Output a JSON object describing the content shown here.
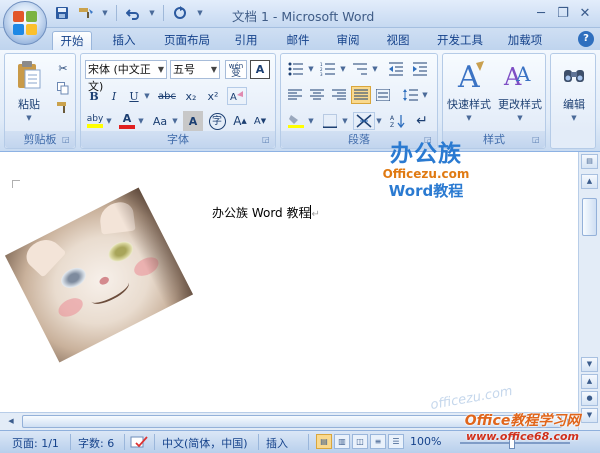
{
  "window": {
    "title": "文档 1 - Microsoft Word"
  },
  "qat": {
    "icons": [
      "save-icon",
      "format-painter-icon",
      "undo-icon",
      "redo-icon",
      "customize-icon"
    ]
  },
  "tabs": [
    {
      "label": "开始"
    },
    {
      "label": "插入"
    },
    {
      "label": "页面布局"
    },
    {
      "label": "引用"
    },
    {
      "label": "邮件"
    },
    {
      "label": "审阅"
    },
    {
      "label": "视图"
    },
    {
      "label": "开发工具"
    },
    {
      "label": "加载项"
    }
  ],
  "help_label": "?",
  "ribbon": {
    "clipboard": {
      "label": "剪贴板",
      "paste_label": "粘贴"
    },
    "font": {
      "label": "字体",
      "font_name": "宋体 (中文正文)",
      "font_size": "五号",
      "bold": "B",
      "italic": "I",
      "underline": "U",
      "strike": "abc",
      "subscript": "x₂",
      "superscript": "x²",
      "highlight": "aby",
      "font_color": "A",
      "change_case": "Aa",
      "char_shading": "A",
      "enclose": "字",
      "grow": "A",
      "shrink": "A",
      "clear": "A",
      "phonetic": "wén",
      "char_border": "A"
    },
    "paragraph": {
      "label": "段落"
    },
    "styles": {
      "label": "样式",
      "quick_styles": "快速样式",
      "change_styles": "更改样式"
    },
    "editing": {
      "label": "编辑"
    }
  },
  "document": {
    "text": "办公族 Word 教程",
    "para_mark": "↵"
  },
  "watermark": {
    "top": "办公族",
    "mid": "Officezu.com",
    "bot": "Word教程",
    "faint": "officezu.com"
  },
  "status": {
    "page": "页面: 1/1",
    "words": "字数: 6",
    "language": "中文(简体，中国)",
    "insert": "插入",
    "zoom": "100%"
  },
  "footer_brand": {
    "top": "Office教程学习网",
    "url": "www.office68.com"
  }
}
